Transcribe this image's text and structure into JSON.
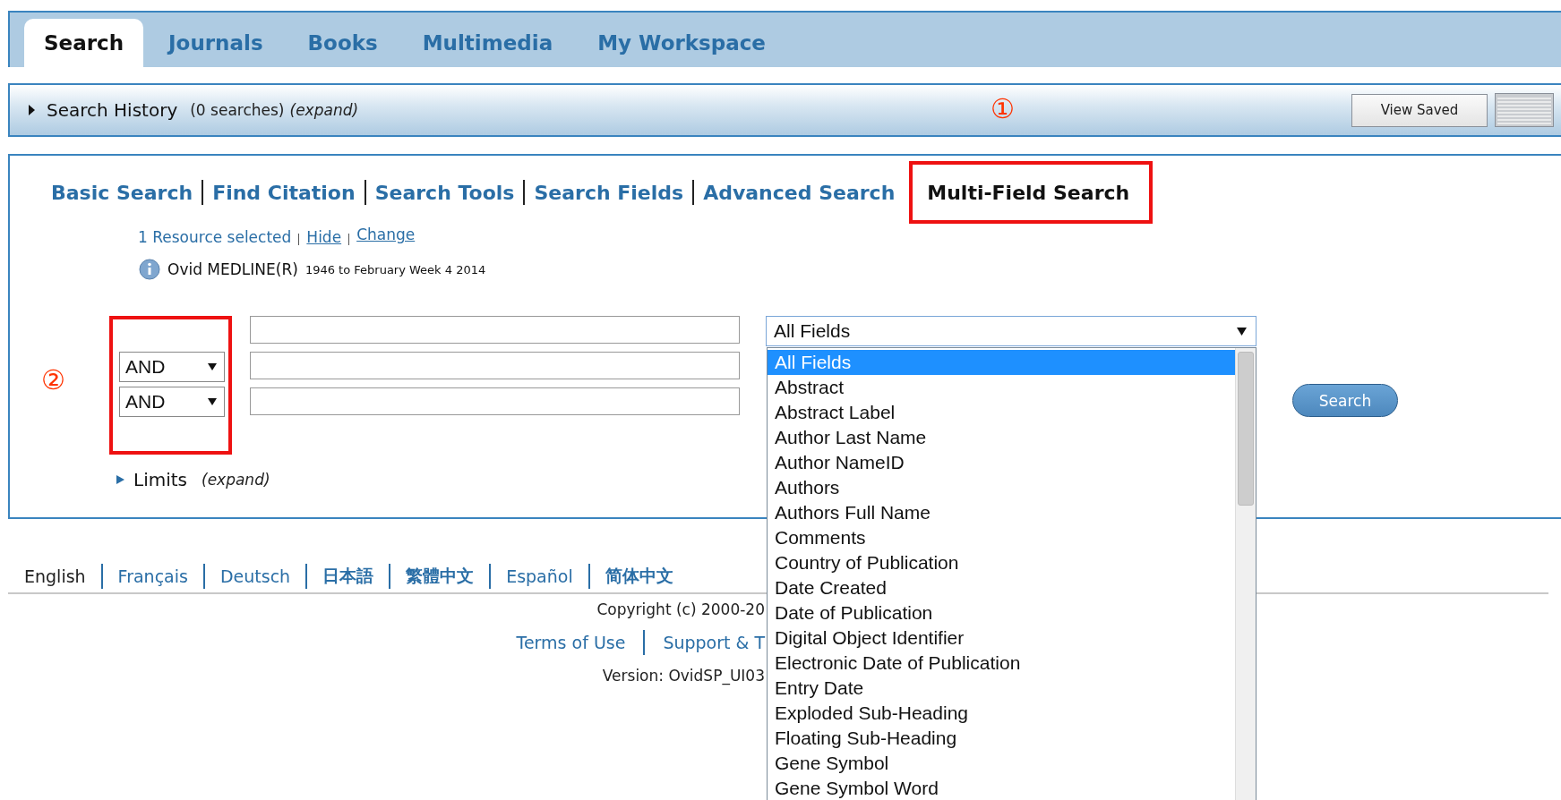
{
  "tabs": [
    {
      "label": "Search",
      "selected": true
    },
    {
      "label": "Journals",
      "selected": false
    },
    {
      "label": "Books",
      "selected": false
    },
    {
      "label": "Multimedia",
      "selected": false
    },
    {
      "label": "My Workspace",
      "selected": false
    }
  ],
  "history": {
    "title": "Search History",
    "count": "(0 searches)",
    "expand": "(expand)",
    "marker": "①",
    "view_saved": "View Saved"
  },
  "subnav": [
    {
      "label": "Basic Search",
      "selected": false
    },
    {
      "label": "Find Citation",
      "selected": false
    },
    {
      "label": "Search Tools",
      "selected": false
    },
    {
      "label": "Search Fields",
      "selected": false
    },
    {
      "label": "Advanced Search",
      "selected": false
    },
    {
      "label": "Multi-Field Search",
      "selected": true
    }
  ],
  "resource": {
    "selected": "1 Resource selected",
    "hide": "Hide",
    "change": "Change",
    "database": "Ovid MEDLINE(R)",
    "coverage": "1946 to February Week 4 2014"
  },
  "operator_marker": "②",
  "operators": [
    "AND",
    "AND"
  ],
  "field_select": {
    "value": "All Fields",
    "options": [
      {
        "label": "All Fields",
        "selected": true
      },
      {
        "label": "Abstract",
        "selected": false
      },
      {
        "label": "Abstract Label",
        "selected": false
      },
      {
        "label": "Author Last Name",
        "selected": false
      },
      {
        "label": "Author NameID",
        "selected": false
      },
      {
        "label": "Authors",
        "selected": false
      },
      {
        "label": "Authors Full Name",
        "selected": false
      },
      {
        "label": "Comments",
        "selected": false
      },
      {
        "label": "Country of Publication",
        "selected": false
      },
      {
        "label": "Date Created",
        "selected": false
      },
      {
        "label": "Date of Publication",
        "selected": false
      },
      {
        "label": "Digital Object Identifier",
        "selected": false
      },
      {
        "label": "Electronic Date of Publication",
        "selected": false
      },
      {
        "label": "Entry Date",
        "selected": false
      },
      {
        "label": "Exploded Sub-Heading",
        "selected": false
      },
      {
        "label": "Floating Sub-Heading",
        "selected": false
      },
      {
        "label": "Gene Symbol",
        "selected": false
      },
      {
        "label": "Gene Symbol Word",
        "selected": false
      }
    ]
  },
  "search_button": "Search",
  "limits": {
    "label": "Limits",
    "expand": "(expand)"
  },
  "languages": [
    {
      "label": "English",
      "selected": true
    },
    {
      "label": "Français",
      "selected": false
    },
    {
      "label": "Deutsch",
      "selected": false
    },
    {
      "label": "日本語",
      "selected": false
    },
    {
      "label": "繁體中文",
      "selected": false
    },
    {
      "label": "Español",
      "selected": false
    },
    {
      "label": "简体中文",
      "selected": false
    }
  ],
  "footer": {
    "copyright": "Copyright (c) 2000-20",
    "links": [
      "Terms of Use",
      "Support & T"
    ],
    "version": "Version: OvidSP_UI03"
  }
}
